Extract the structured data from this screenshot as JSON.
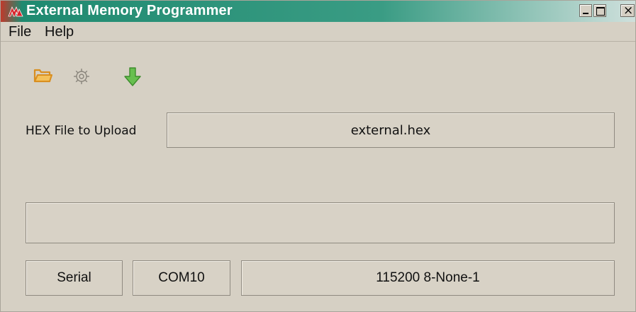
{
  "window": {
    "title": "External Memory Programmer",
    "close_glyph": "×"
  },
  "menu": {
    "file": "File",
    "help": "Help"
  },
  "toolbar": {
    "icons": [
      "folder-open-icon",
      "gear-icon",
      "download-arrow-icon"
    ]
  },
  "hex": {
    "label": "HEX File to Upload",
    "value": "external.hex"
  },
  "status": {
    "text": ""
  },
  "connection": {
    "type": "Serial",
    "port": "COM10",
    "settings": "115200 8-None-1"
  },
  "colors": {
    "window_bg": "#d6d0c4",
    "title_text": "#ffffff",
    "logo": "#d8232a",
    "folder": "#e6a23c",
    "download": "#5bb048"
  }
}
